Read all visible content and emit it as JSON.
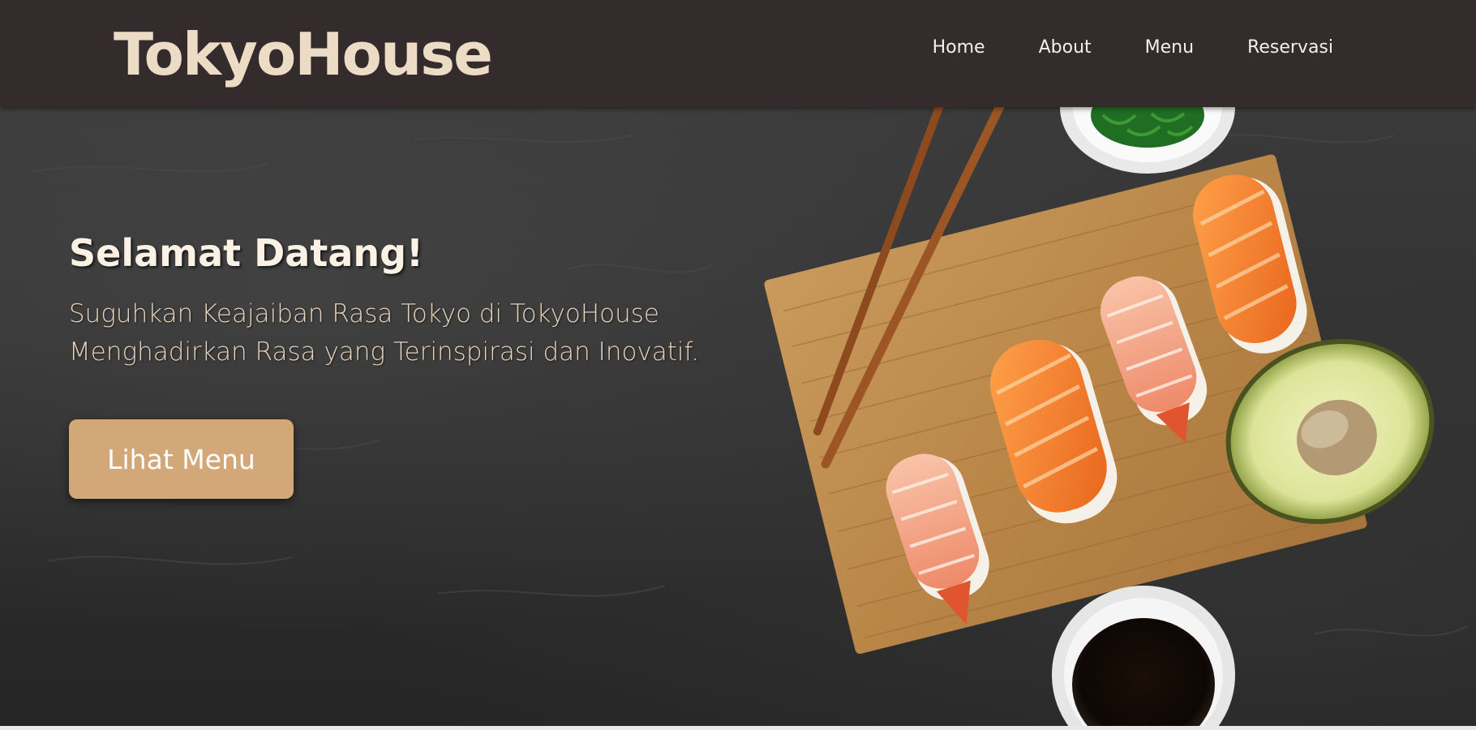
{
  "navbar": {
    "brand": "TokyoHouse",
    "links": [
      "Home",
      "About",
      "Menu",
      "Reservasi"
    ]
  },
  "hero": {
    "title": "Selamat Datang!",
    "subtitle_lines": [
      "Suguhkan Keajaiban Rasa Tokyo di TokyoHouse",
      "Menghadirkan Rasa yang Terinspirasi dan Inovatif."
    ],
    "cta_label": "Lihat Menu",
    "image_subject": "sushi platter on wooden board with chopsticks, avocado, seaweed salad and soy sauce"
  },
  "colors": {
    "navbar_bg": "#342b2c",
    "brand": "#ecdcc6",
    "accent_button": "#d3a878",
    "hero_bg": "#333334"
  }
}
